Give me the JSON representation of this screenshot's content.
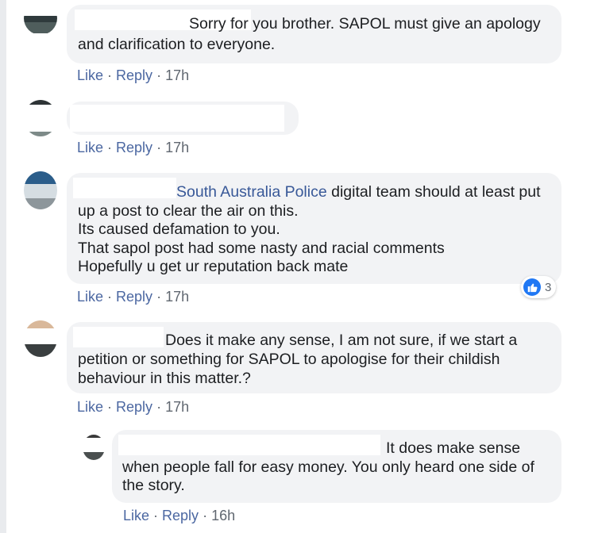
{
  "comments": [
    {
      "name": "",
      "lines": [
        "Sorry for you brother. SAPOL must give an apology",
        "and clarification to everyone."
      ],
      "actions": {
        "like": "Like",
        "reply": "Reply",
        "sep": " · ",
        "time": "17h"
      }
    },
    {
      "name": "",
      "lines": [],
      "actions": {
        "like": "Like",
        "reply": "Reply",
        "sep": " · ",
        "time": "17h"
      }
    },
    {
      "mention": "South Australia Police",
      "lines": [
        " digital team should at least put",
        "up a post to clear the air on this.",
        "Its caused defamation to you.",
        "That sapol post had some nasty and racial comments",
        "Hopefully u get ur reputation back mate"
      ],
      "reaction_icon": "like-icon",
      "reaction_count": "3",
      "actions": {
        "like": "Like",
        "reply": "Reply",
        "sep": " · ",
        "time": "17h"
      }
    },
    {
      "lines": [
        "Does it make any sense, I am not sure, if we start a",
        "petition or something for SAPOL to apologise for their childish",
        "behaviour in this matter.?"
      ],
      "actions": {
        "like": "Like",
        "reply": "Reply",
        "sep": " · ",
        "time": "17h"
      }
    },
    {
      "lines": [
        "It does make sense",
        "when people fall for easy money. You only heard one side of",
        "the story."
      ],
      "actions": {
        "like": "Like",
        "reply": "Reply",
        "sep": " · ",
        "time": "16h"
      }
    }
  ],
  "colors": {
    "bubble": "#f2f3f5",
    "link": "#385898",
    "action": "#4b67a1",
    "meta": "#606770",
    "like_blue": "#2078f4"
  }
}
